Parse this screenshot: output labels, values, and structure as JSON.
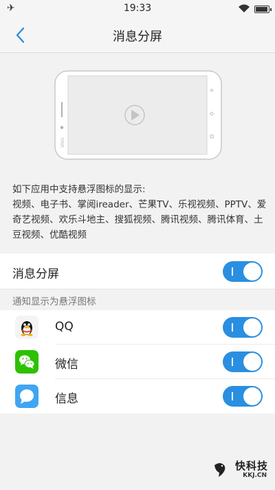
{
  "status_bar": {
    "time": "19:33"
  },
  "header": {
    "title": "消息分屏"
  },
  "description": {
    "intro": "如下应用中支持悬浮图标的显示:",
    "apps": "视频、电子书、掌阅ireader、芒果TV、乐视视频、PPTV、爱奇艺视频、欢乐斗地主、搜狐视频、腾讯视频、腾讯体育、土豆视频、优酷视频"
  },
  "main_setting": {
    "label": "消息分屏",
    "toggle_on": true
  },
  "section": {
    "header": "通知显示为悬浮图标"
  },
  "apps": [
    {
      "name": "QQ",
      "icon": "qq-icon",
      "toggle_on": true
    },
    {
      "name": "微信",
      "icon": "wechat-icon",
      "toggle_on": true
    },
    {
      "name": "信息",
      "icon": "messages-icon",
      "toggle_on": true
    }
  ],
  "watermark": {
    "brand": "快科技",
    "domain": "KKJ.CN"
  },
  "colors": {
    "accent": "#2a8fe0",
    "back": "#2a8fe0",
    "background": "#f2f2f2"
  }
}
